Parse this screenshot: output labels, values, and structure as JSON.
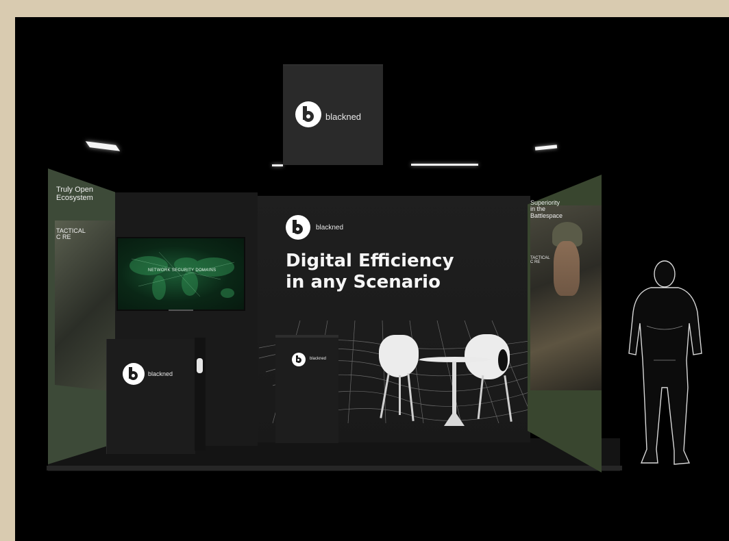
{
  "hanging_sign": {
    "brand": "blackned"
  },
  "backdrop": {
    "brand": "blackned",
    "headline_line1": "Digital Efficiency",
    "headline_line2": "in any Scenario"
  },
  "left_panel": {
    "line1": "Truly Open",
    "line2": "Ecosystem",
    "product_line1": "TACTICAL",
    "product_line2": "C RE"
  },
  "right_panel": {
    "line1": "Superiority",
    "line2": "in the",
    "line3": "Battlespace",
    "product_line1": "TACTICAL",
    "product_line2": "C RE"
  },
  "tv_screen": {
    "caption": "NETWORK SECURITY DOMAINS"
  },
  "counter_left": {
    "brand": "blackned"
  },
  "counter_center": {
    "brand": "blackned"
  },
  "colors": {
    "outer_border": "#d9cbb0",
    "background": "#000000",
    "side_panel_green": "#3d4a38",
    "sign_gray": "#2a2a2a"
  }
}
